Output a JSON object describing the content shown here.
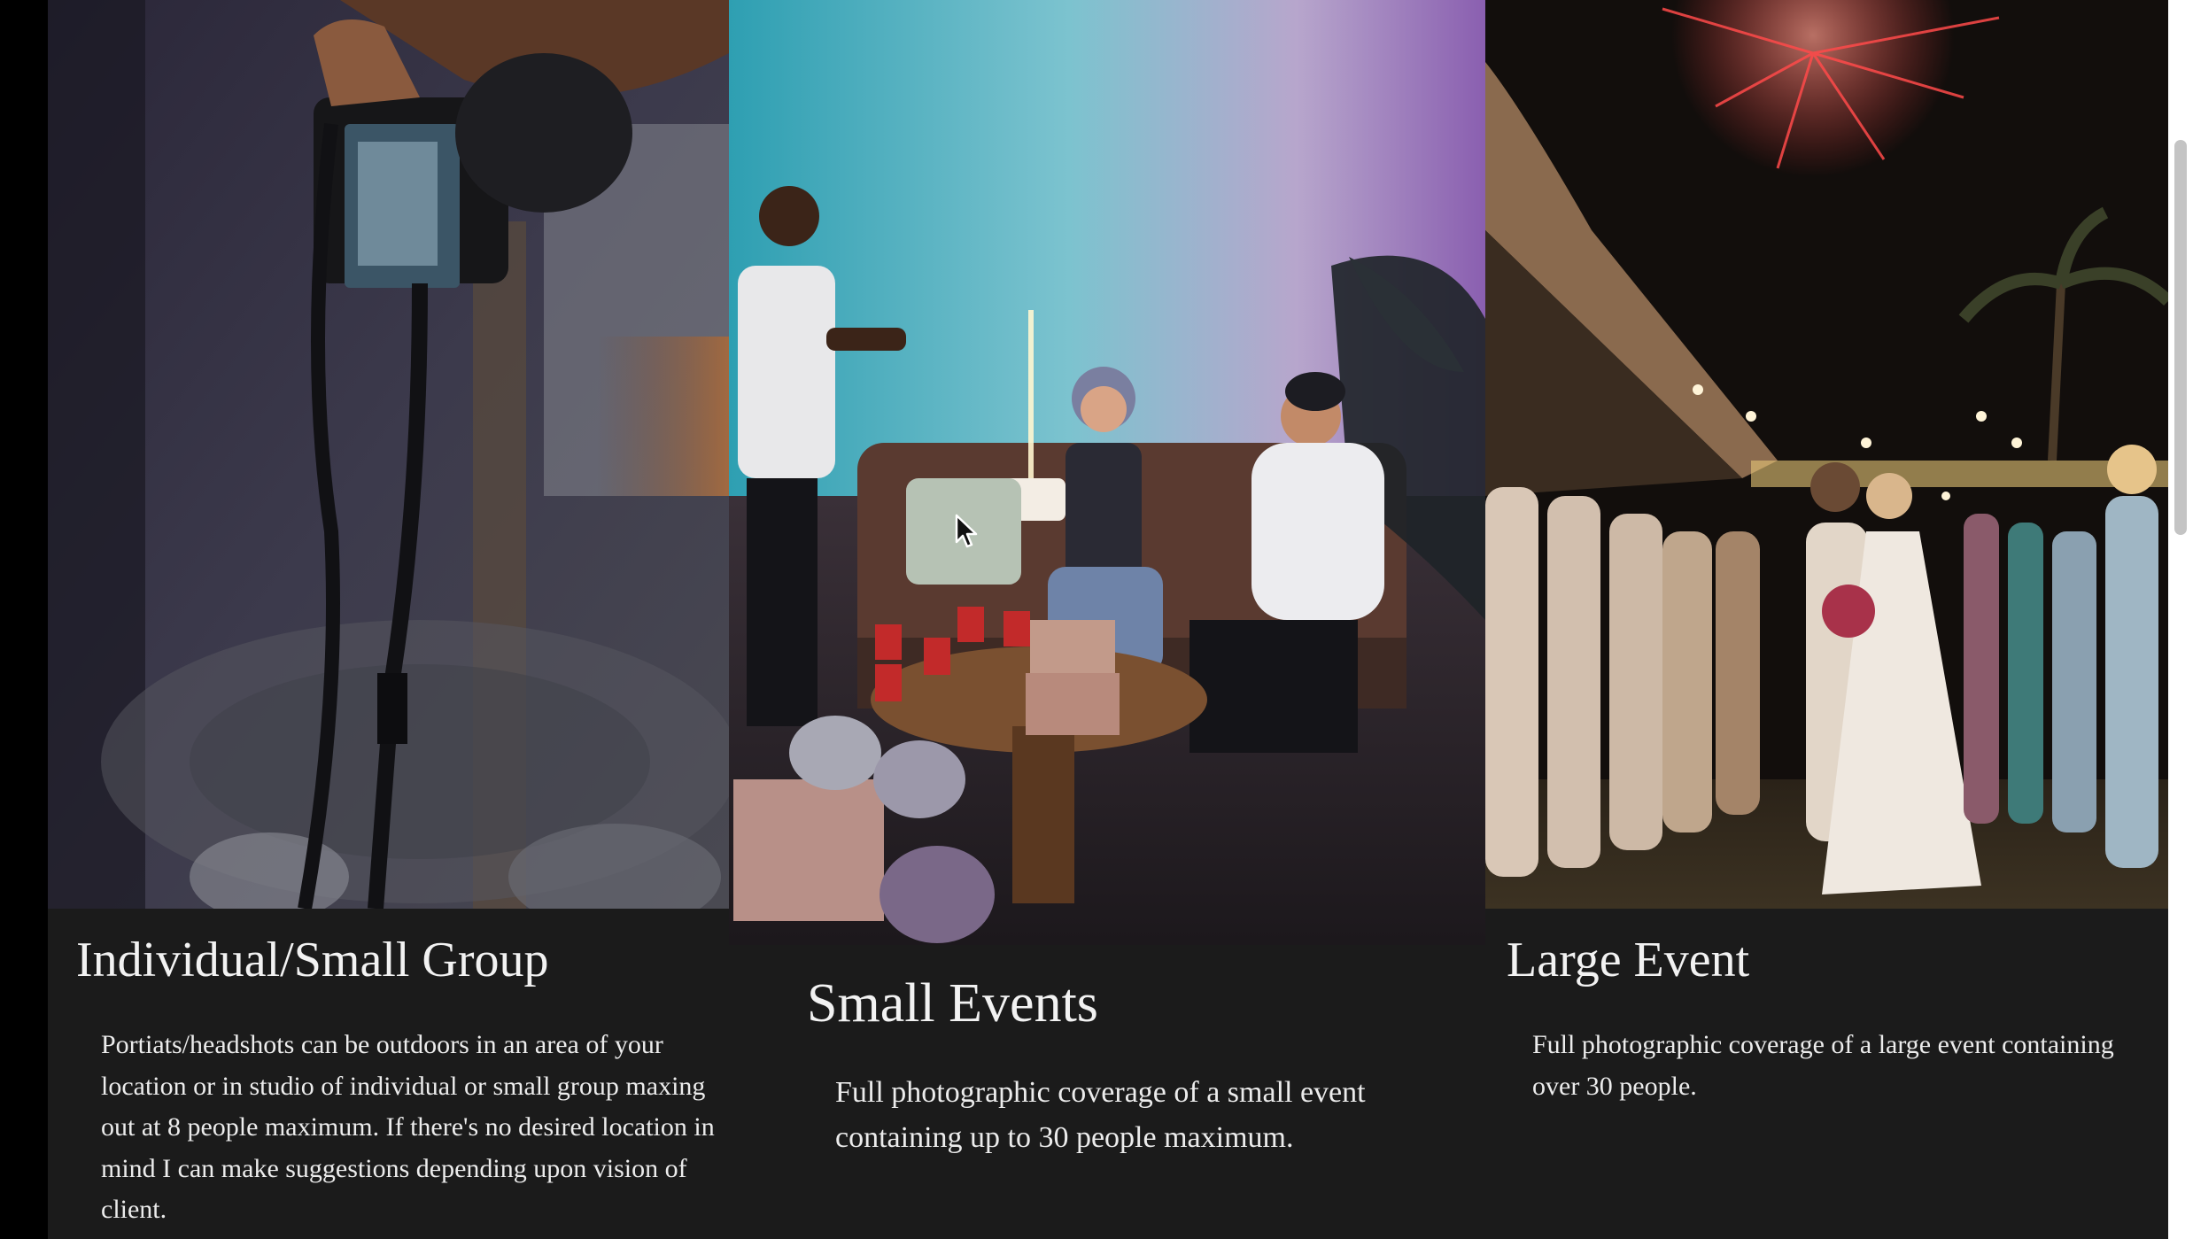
{
  "services": [
    {
      "title": "Individual/Small Group",
      "description": "Portiats/headshots can be outdoors in an area of your location or in studio of individual or small group maxing out at 8 people maximum. If there's no desired location in mind I can make suggestions depending upon vision of client."
    },
    {
      "title": "Small Events",
      "description": "Full photographic coverage of a small event containing up to 30 people maximum."
    },
    {
      "title": "Large Event",
      "description": "Full photographic coverage of a large event containing over 30 people."
    }
  ],
  "colors": {
    "page_background": "#1b1b1b",
    "outer_background": "#000000",
    "title_text": "#f2f2f2",
    "body_text": "#ececec",
    "scrollbar_track": "#ffffff",
    "scrollbar_thumb": "#c4c4c4"
  },
  "icons": [
    "mouse-pointer-icon"
  ]
}
